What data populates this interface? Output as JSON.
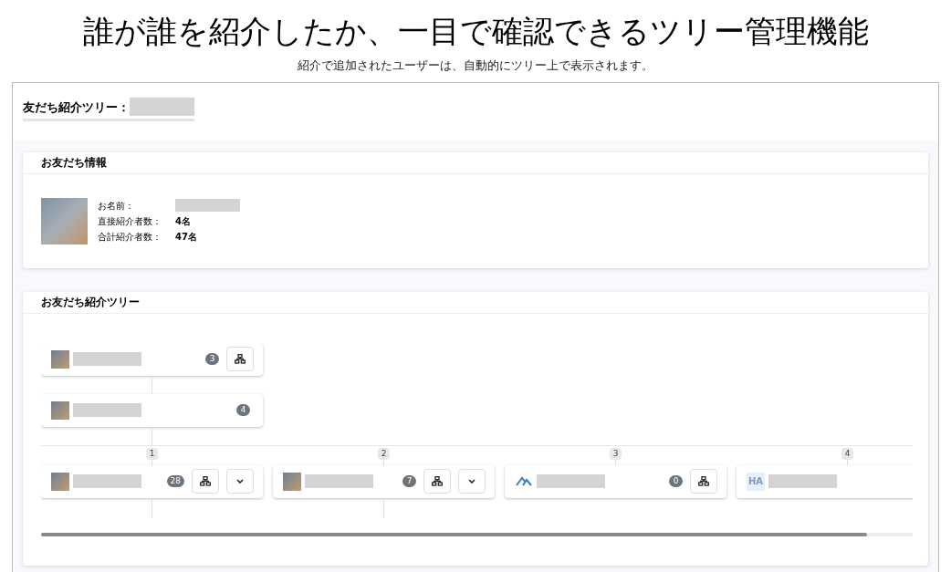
{
  "headline": "誰が誰を紹介したか、一目で確認できるツリー管理機能",
  "subheadline": "紹介で追加されたユーザーは、自動的にツリー上で表示されます。",
  "page_title": "友だち紹介ツリー：",
  "info_card": {
    "title": "お友だち情報",
    "fields": [
      {
        "label": "お名前："
      },
      {
        "label": "直接紹介者数：",
        "value": "4名"
      },
      {
        "label": "合計紹介者数：",
        "value": "47名"
      }
    ]
  },
  "tree_card": {
    "title": "お友だち紹介ツリー",
    "ancestors": [
      {
        "kind": "photo",
        "count": "3",
        "tree_button": true,
        "expand_button": false
      },
      {
        "kind": "photo",
        "count": "4",
        "tree_button": false,
        "expand_button": false
      }
    ],
    "children": [
      {
        "index": "1",
        "kind": "photo",
        "count": "28",
        "tree_button": true,
        "expand_button": true
      },
      {
        "index": "2",
        "kind": "photo",
        "count": "7",
        "tree_button": true,
        "expand_button": true
      },
      {
        "index": "3",
        "kind": "logo",
        "count": "0",
        "tree_button": true,
        "expand_button": false
      },
      {
        "index": "4",
        "kind": "initials",
        "initials": "HA"
      }
    ]
  }
}
